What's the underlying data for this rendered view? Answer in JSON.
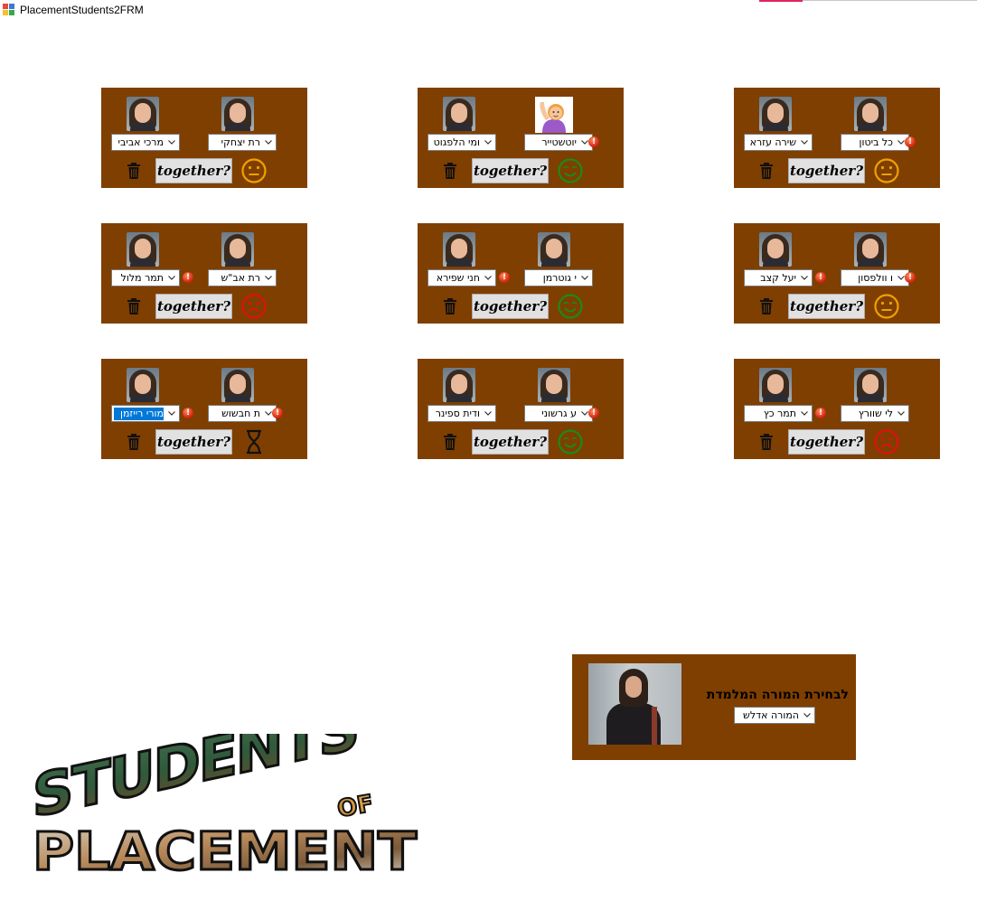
{
  "window": {
    "title": "PlacementStudents2FRM"
  },
  "colors": {
    "card_bg": "#7f3f00",
    "happy": "#1b8a1b",
    "neutral": "#f0a000",
    "sad": "#e01010"
  },
  "together_label": "together?",
  "pairs": [
    {
      "left_name": "מרכי אביבי",
      "right_name": "רת יצחקי",
      "left_warn": false,
      "right_warn": false,
      "mood": "neutral"
    },
    {
      "left_name": "ומי הלפגוט",
      "right_name": "יוטשטייר",
      "left_warn": false,
      "right_warn": true,
      "mood": "happy",
      "right_emoji": "raising-hand-emoji"
    },
    {
      "left_name": "שירה עזרא",
      "right_name": "כל ביטון",
      "left_warn": false,
      "right_warn": true,
      "mood": "neutral"
    },
    {
      "left_name": "תמר מלול",
      "right_name": "רת אב\"ש",
      "left_warn": true,
      "right_warn": false,
      "mood": "sad"
    },
    {
      "left_name": "חני שפירא",
      "right_name": "י גוטרמן",
      "left_warn": true,
      "right_warn": false,
      "mood": "happy"
    },
    {
      "left_name": "יעל קצב",
      "right_name": "ו וולפסון",
      "left_warn": true,
      "right_warn": true,
      "mood": "neutral"
    },
    {
      "left_name": "מורי רייזמן",
      "right_name": "ת חבשוש",
      "left_warn": true,
      "right_warn": true,
      "mood": "hourglass",
      "left_selected": true
    },
    {
      "left_name": "ודית ספינר",
      "right_name": "ע גרשוני",
      "left_warn": false,
      "right_warn": true,
      "mood": "happy"
    },
    {
      "left_name": "תמר כץ",
      "right_name": "לי שוורץ",
      "left_warn": true,
      "right_warn": false,
      "mood": "sad"
    }
  ],
  "teacher": {
    "label": "לבחירת המורה המלמדת",
    "selected": "המורה אדלש"
  },
  "logo": {
    "line1": "STUDENTS",
    "line2": "OF",
    "line3": "PLACEMENT"
  }
}
